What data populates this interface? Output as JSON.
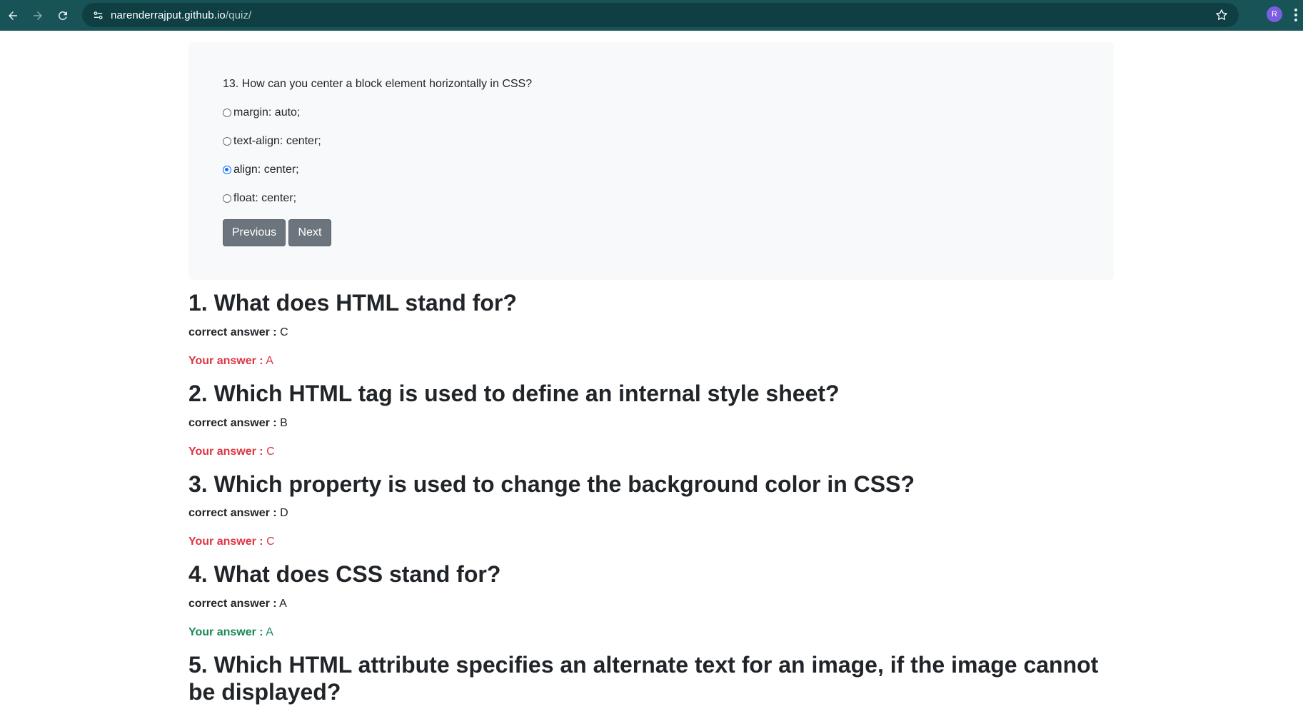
{
  "browser": {
    "url_host": "narenderrajput.github.io",
    "url_path": "/quiz/",
    "profile_initial": "R"
  },
  "quiz": {
    "question": "13. How can you center a block element horizontally in CSS?",
    "options": [
      {
        "label": "margin: auto;",
        "checked": false
      },
      {
        "label": "text-align: center;",
        "checked": false
      },
      {
        "label": "align: center;",
        "checked": true
      },
      {
        "label": "float: center;",
        "checked": false
      }
    ],
    "previous_label": "Previous",
    "next_label": "Next"
  },
  "results": {
    "correct_label": "correct answer :",
    "your_label": "Your answer :",
    "items": [
      {
        "title": "1. What does HTML stand for?",
        "correct": "C",
        "yours": "A",
        "status": "wrong"
      },
      {
        "title": "2. Which HTML tag is used to define an internal style sheet?",
        "correct": "B",
        "yours": "C",
        "status": "wrong"
      },
      {
        "title": "3. Which property is used to change the background color in CSS?",
        "correct": "D",
        "yours": "C",
        "status": "wrong"
      },
      {
        "title": "4. What does CSS stand for?",
        "correct": "A",
        "yours": "A",
        "status": "right"
      },
      {
        "title": "5. Which HTML attribute specifies an alternate text for an image, if the image cannot be displayed?"
      }
    ]
  },
  "colors": {
    "chrome": "#175357",
    "wrong": "#dc3545",
    "right": "#198754",
    "button": "#6c757d",
    "card": "#f8f9fa"
  }
}
